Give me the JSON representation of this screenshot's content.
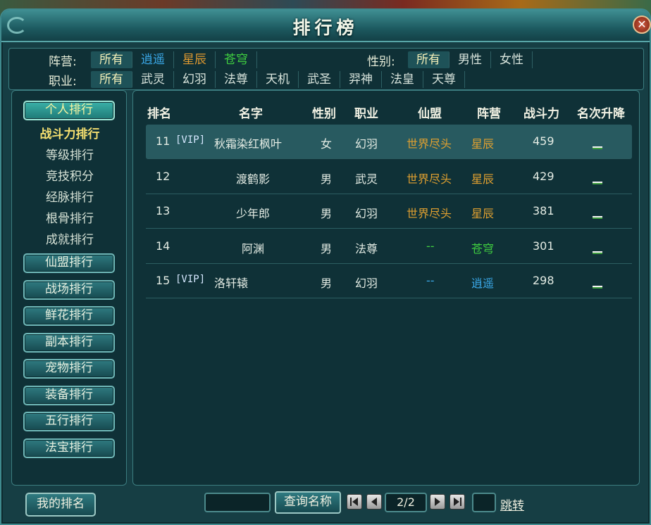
{
  "window": {
    "title": "排行榜"
  },
  "filters": {
    "camp_label": "阵营:",
    "camp_options": [
      {
        "label": "所有",
        "style": "sel"
      },
      {
        "label": "逍遥",
        "style": "blue"
      },
      {
        "label": "星辰",
        "style": "orange"
      },
      {
        "label": "苍穹",
        "style": "green"
      }
    ],
    "gender_label": "性别:",
    "gender_options": [
      {
        "label": "所有",
        "style": "sel"
      },
      {
        "label": "男性",
        "style": "white"
      },
      {
        "label": "女性",
        "style": "white"
      }
    ],
    "class_label": "职业:",
    "class_options": [
      {
        "label": "所有",
        "style": "sel"
      },
      {
        "label": "武灵",
        "style": "white"
      },
      {
        "label": "幻羽",
        "style": "white"
      },
      {
        "label": "法尊",
        "style": "white"
      },
      {
        "label": "天机",
        "style": "white"
      },
      {
        "label": "武圣",
        "style": "white"
      },
      {
        "label": "羿神",
        "style": "white"
      },
      {
        "label": "法皇",
        "style": "white"
      },
      {
        "label": "天尊",
        "style": "white"
      }
    ]
  },
  "nav": {
    "personal": "个人排行",
    "sub_items": [
      "战斗力排行",
      "等级排行",
      "竞技积分",
      "经脉排行",
      "根骨排行",
      "成就排行"
    ],
    "buttons": [
      "仙盟排行",
      "战场排行",
      "鲜花排行",
      "副本排行",
      "宠物排行",
      "装备排行",
      "五行排行",
      "法宝排行"
    ]
  },
  "table": {
    "headers": [
      "排名",
      "名字",
      "性别",
      "职业",
      "仙盟",
      "阵营",
      "战斗力",
      "名次升降"
    ],
    "rows": [
      {
        "rank": "11",
        "vip": "[VIP]",
        "name": "秋霜染红枫叶",
        "gender": "女",
        "class": "幻羽",
        "guild": "世界尽头",
        "camp": "星辰",
        "camp_color": "gold",
        "power": "459"
      },
      {
        "rank": "12",
        "vip": "",
        "name": "渡鹤影",
        "gender": "男",
        "class": "武灵",
        "guild": "世界尽头",
        "camp": "星辰",
        "camp_color": "gold",
        "power": "429"
      },
      {
        "rank": "13",
        "vip": "",
        "name": "少年郎",
        "gender": "男",
        "class": "幻羽",
        "guild": "世界尽头",
        "camp": "星辰",
        "camp_color": "gold",
        "power": "381"
      },
      {
        "rank": "14",
        "vip": "",
        "name": "阿渊",
        "gender": "男",
        "class": "法尊",
        "guild": "--",
        "guild_color": "green",
        "camp": "苍穹",
        "camp_color": "green",
        "power": "301"
      },
      {
        "rank": "15",
        "vip": "[VIP]",
        "name": "洛轩辕",
        "gender": "男",
        "class": "幻羽",
        "guild": "--",
        "guild_color": "blue",
        "camp": "逍遥",
        "camp_color": "blue",
        "power": "298"
      }
    ]
  },
  "bottom": {
    "my_rank": "我的排名",
    "search_placeholder": "",
    "query_button": "查询名称",
    "page": "2/2",
    "jump": "跳转"
  },
  "icons": {
    "close": "close-icon",
    "first": "first-page-icon",
    "prev": "prev-page-icon",
    "next": "next-page-icon",
    "last": "last-page-icon",
    "rank_change": "rank-unchanged-icon"
  }
}
